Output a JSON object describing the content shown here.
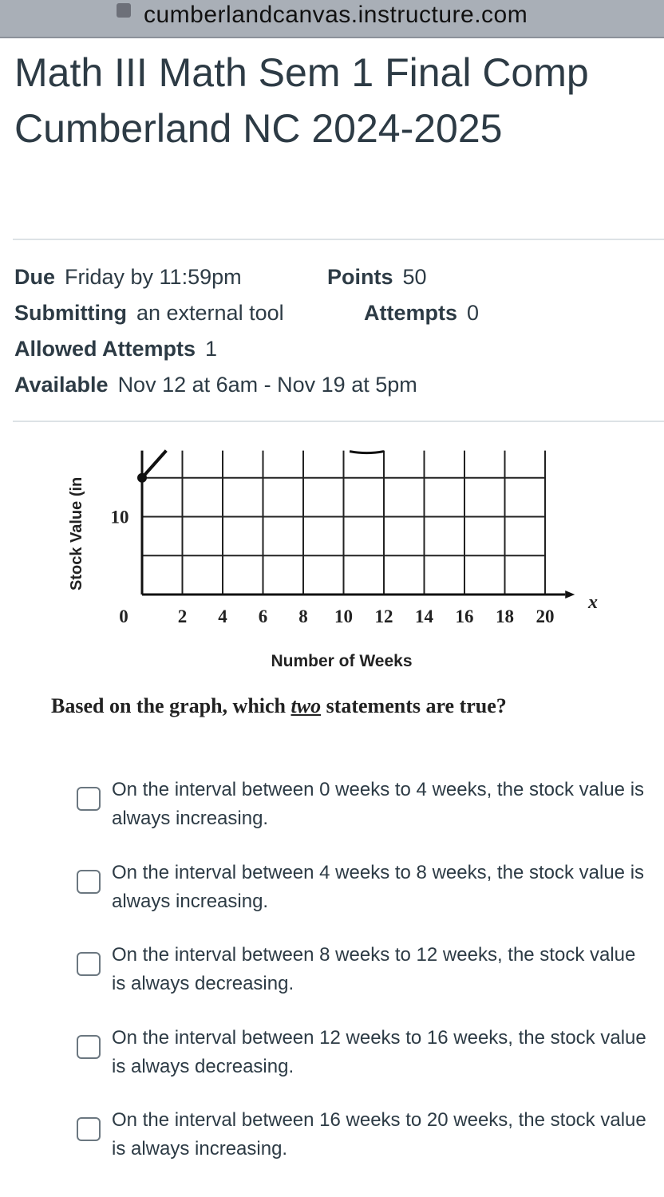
{
  "browser": {
    "url": "cumberlandcanvas.instructure.com",
    "lock_icon": "lock-icon"
  },
  "title": "Math III Math Sem 1 Final Comp Cumberland NC 2024-2025",
  "details": {
    "due_label": "Due",
    "due_value": "Friday by 11:59pm",
    "points_label": "Points",
    "points_value": "50",
    "submitting_label": "Submitting",
    "submitting_value": "an external tool",
    "attempts_label": "Attempts",
    "attempts_value": "0",
    "allowed_label": "Allowed Attempts",
    "allowed_value": "1",
    "available_label": "Available",
    "available_value": "Nov 12 at 6am - Nov 19 at 5pm"
  },
  "chart_data": {
    "type": "line",
    "xlabel": "Number of Weeks",
    "ylabel": "Stock Value (in",
    "x_axis_symbol": "x",
    "x_ticks": [
      "0",
      "2",
      "4",
      "6",
      "8",
      "10",
      "12",
      "14",
      "16",
      "18",
      "20"
    ],
    "y_ticks": [
      "10"
    ],
    "xlim": [
      0,
      20
    ],
    "ylim": [
      0,
      18.5
    ],
    "grid": true,
    "series": [
      {
        "points": [
          {
            "x": 0,
            "y": 15
          },
          {
            "x": 1.2,
            "y": 18.5
          }
        ]
      }
    ],
    "note_marks": [
      {
        "x": [
          10.3,
          12
        ],
        "y": 18.5
      }
    ]
  },
  "question": {
    "pre": "Based on the graph, which ",
    "emph": "two",
    "post": " statements are true?"
  },
  "options": [
    {
      "text": "On the interval between 0 weeks to 4 weeks, the stock value is always increasing."
    },
    {
      "text": "On the interval between 4 weeks to 8 weeks, the stock value is always increasing."
    },
    {
      "text": "On the interval between 8 weeks to 12 weeks, the stock value is always decreasing."
    },
    {
      "text": "On the interval between 12 weeks to 16 weeks, the stock value is always decreasing."
    },
    {
      "text": "On the interval between 16 weeks to 20 weeks, the stock value is always increasing."
    }
  ]
}
